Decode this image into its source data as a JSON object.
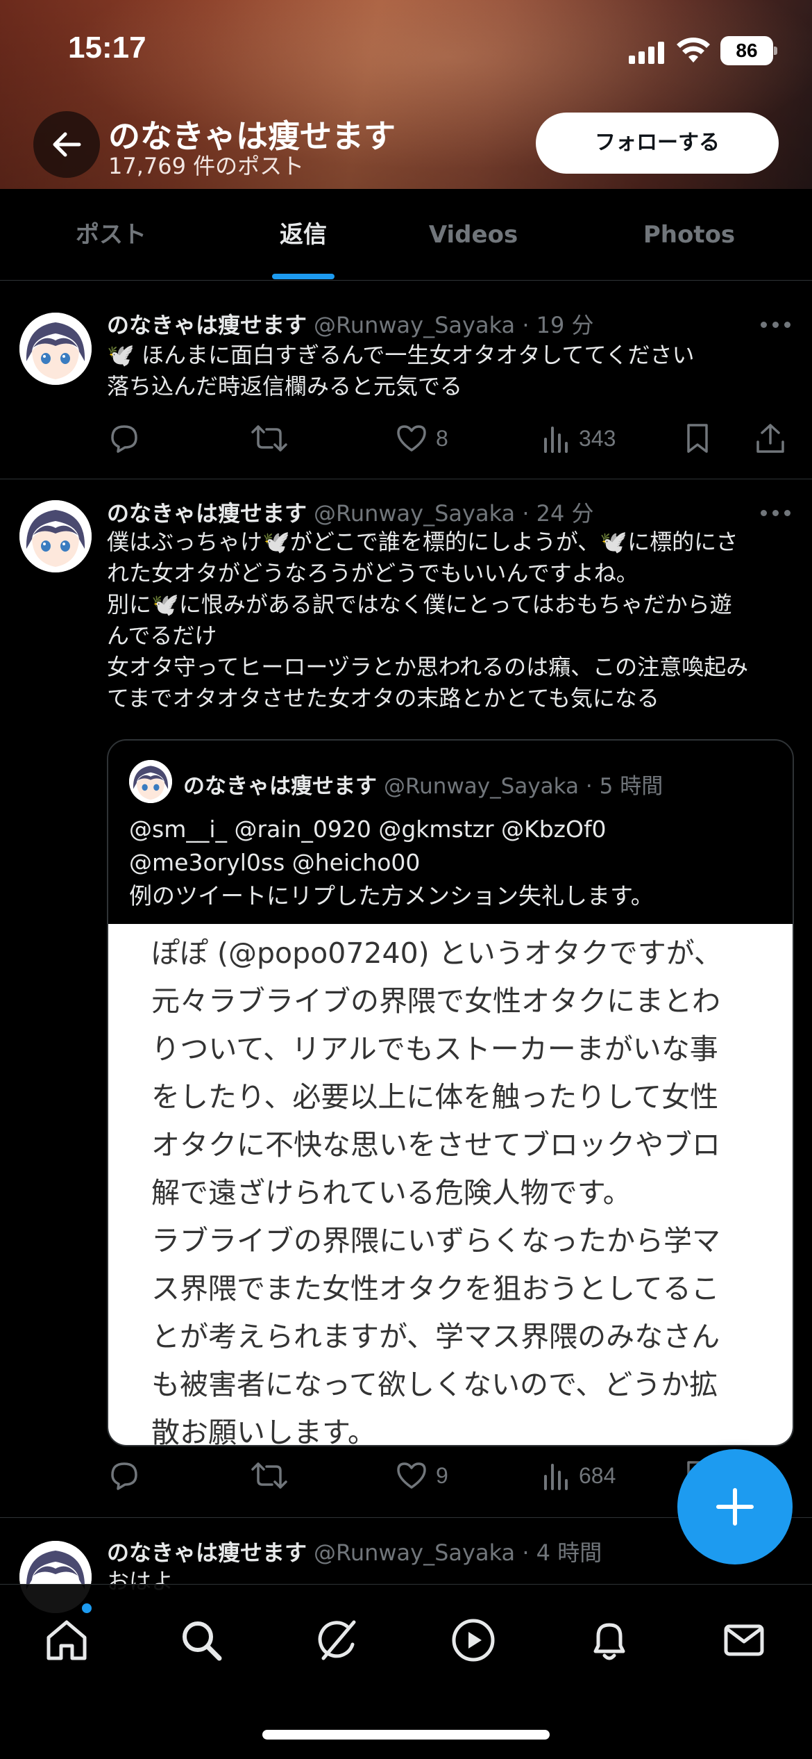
{
  "status_bar": {
    "time": "15:17",
    "battery": "86"
  },
  "header": {
    "profile_name": "のなきゃは痩せます",
    "post_count": "17,769 件のポスト",
    "follow_label": "フォローする"
  },
  "tabs": [
    {
      "label": "ポスト"
    },
    {
      "label": "返信"
    },
    {
      "label": "Videos"
    },
    {
      "label": "Photos"
    }
  ],
  "active_tab": "返信",
  "posts": [
    {
      "name": "のなきゃは痩せます",
      "meta": "@Runway_Sayaka · 19 分",
      "lines": [
        "🕊️ ほんまに面白すぎるんで一生女オタオタしててください",
        "落ち込んだ時返信欄みると元気でる"
      ],
      "likes": "8",
      "views": "343"
    },
    {
      "name": "のなきゃは痩せます",
      "meta": "@Runway_Sayaka · 24 分",
      "lines": [
        "僕はぶっちゃけ🕊️がどこで誰を標的にしようが、🕊️に標的にさ",
        "れた女オタがどうなろうがどうでもいいんですよね。",
        "別に🕊️に恨みがある訳ではなく僕にとってはおもちゃだから遊",
        "んでるだけ",
        "女オタ守ってヒーローヅラとか思われるのは癪、この注意喚起み",
        "てまでオタオタさせた女オタの末路とかとても気になる"
      ],
      "likes": "9",
      "views": "684",
      "quote": {
        "name": "のなきゃは痩せます",
        "meta": "@Runway_Sayaka · 5 時間",
        "lines": [
          "@sm__i_ @rain_0920 @gkmstzr @KbzOf0",
          "@me3oryl0ss @heicho00",
          "例のツイートにリプした方メンション失礼します。"
        ],
        "image_lines": [
          "ぽぽ (@popo07240) というオタクですが、",
          "元々ラブライブの界隈で女性オタクにまとわ",
          "りついて、リアルでもストーカーまがいな事",
          "をしたり、必要以上に体を触ったりして女性",
          "オタクに不快な思いをさせてブロックやブロ",
          "解で遠ざけられている危険人物です。",
          "ラブライブの界隈にいずらくなったから学マ",
          "ス界隈でまた女性オタクを狙おうとしてるこ",
          "とが考えられますが、学マス界隈のみなさん",
          "も被害者になって欲しくないので、どうか拡",
          "散お願いします。"
        ]
      }
    },
    {
      "name": "のなきゃは痩せます",
      "meta": "@Runway_Sayaka · 4 時間",
      "lines": [
        "おはよ"
      ]
    }
  ],
  "icons": {
    "back": "arrow-left-icon",
    "reply": "reply-icon",
    "repost": "repost-icon",
    "like": "heart-icon",
    "views": "views-icon",
    "bookmark": "bookmark-icon",
    "share": "share-icon",
    "compose": "plus-icon",
    "nav": [
      "home-icon",
      "search-icon",
      "grok-icon",
      "video-icon",
      "notifications-icon",
      "messages-icon"
    ]
  },
  "colors": {
    "accent": "#1d9bf0",
    "muted": "#71767b",
    "text": "#e7e9ea",
    "background": "#000000"
  }
}
